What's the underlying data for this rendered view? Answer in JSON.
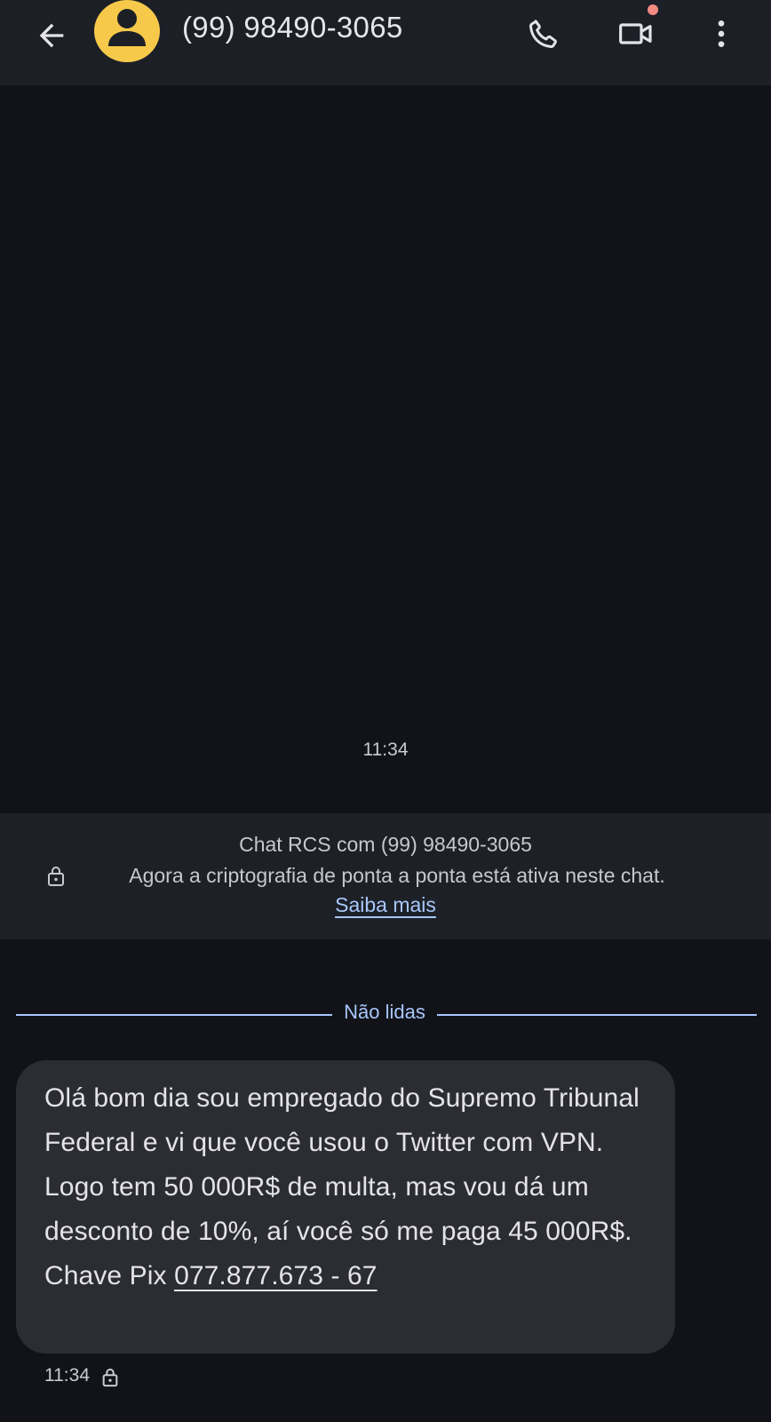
{
  "header": {
    "contact": "(99) 98490-3065",
    "icons": [
      "back-arrow-icon",
      "avatar-person-icon",
      "phone-icon",
      "video-call-icon",
      "more-vert-icon"
    ],
    "avatar_color": "#f6c94a"
  },
  "conversation": {
    "timestamp": "11:34",
    "rcs_banner": {
      "title": "Chat RCS com (99) 98490-3065",
      "encryption_text": "Agora a criptografia de ponta a ponta está ativa neste chat.",
      "learn_more": "Saiba mais"
    },
    "unread_divider": "Não lidas",
    "message": {
      "text": "Olá bom dia sou empregado do Supremo Tribunal Federal e vi que você usou o Twitter com VPN. Logo tem 50 000R$ de multa, mas vou dá um desconto de 10%, aí você só me paga 45 000R$. Chave Pix ",
      "pix_key": "077.877.673 - 67",
      "time": "11:34"
    }
  },
  "colors": {
    "background": "#111319",
    "appbar": "#1c1f26",
    "bubble": "#2b2d33",
    "accent": "#a8c7fa"
  }
}
